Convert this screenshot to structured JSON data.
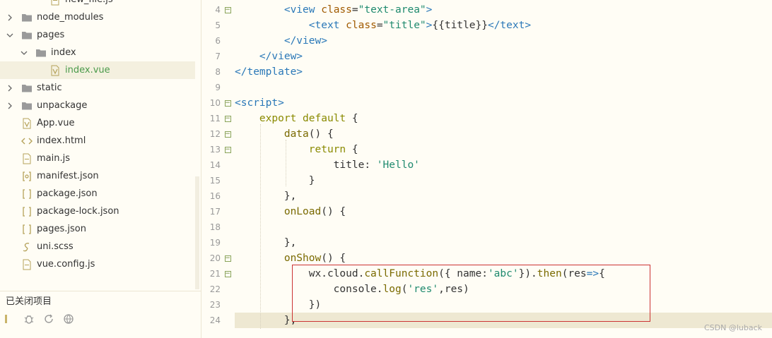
{
  "sidebar": {
    "items": [
      {
        "label": "new_file.js",
        "type": "file-js",
        "indent": 2,
        "chevron": "",
        "selected": false
      },
      {
        "label": "node_modules",
        "type": "folder",
        "indent": 0,
        "chevron": "right",
        "selected": false
      },
      {
        "label": "pages",
        "type": "folder",
        "indent": 0,
        "chevron": "down",
        "selected": false
      },
      {
        "label": "index",
        "type": "folder",
        "indent": 1,
        "chevron": "down",
        "selected": false
      },
      {
        "label": "index.vue",
        "type": "file-vue",
        "indent": 2,
        "chevron": "",
        "selected": true
      },
      {
        "label": "static",
        "type": "folder",
        "indent": 0,
        "chevron": "right",
        "selected": false
      },
      {
        "label": "unpackage",
        "type": "folder",
        "indent": 0,
        "chevron": "right",
        "selected": false
      },
      {
        "label": "App.vue",
        "type": "file-vue",
        "indent": 0,
        "chevron": "",
        "selected": false
      },
      {
        "label": "index.html",
        "type": "file-html",
        "indent": 0,
        "chevron": "",
        "selected": false
      },
      {
        "label": "main.js",
        "type": "file-js",
        "indent": 0,
        "chevron": "",
        "selected": false
      },
      {
        "label": "manifest.json",
        "type": "file-manifest",
        "indent": 0,
        "chevron": "",
        "selected": false
      },
      {
        "label": "package.json",
        "type": "file-json",
        "indent": 0,
        "chevron": "",
        "selected": false
      },
      {
        "label": "package-lock.json",
        "type": "file-json",
        "indent": 0,
        "chevron": "",
        "selected": false
      },
      {
        "label": "pages.json",
        "type": "file-json",
        "indent": 0,
        "chevron": "",
        "selected": false
      },
      {
        "label": "uni.scss",
        "type": "file-scss",
        "indent": 0,
        "chevron": "",
        "selected": false
      },
      {
        "label": "vue.config.js",
        "type": "file-js",
        "indent": 0,
        "chevron": "",
        "selected": false
      }
    ],
    "closed_projects_label": "已关闭项目",
    "toolbar_icons": [
      "collapse-icon",
      "bug-icon",
      "refresh-icon",
      "globe-icon"
    ]
  },
  "editor": {
    "current_line": 24,
    "lines": [
      {
        "n": "4",
        "fold": true,
        "tokens": [
          [
            "t-plain",
            "        "
          ],
          [
            "t-tag",
            "<view"
          ],
          [
            "t-plain",
            " "
          ],
          [
            "t-attr",
            "class"
          ],
          [
            "t-plain",
            "="
          ],
          [
            "t-str",
            "\"text-area\""
          ],
          [
            "t-tag",
            ">"
          ]
        ]
      },
      {
        "n": "5",
        "fold": false,
        "tokens": [
          [
            "t-plain",
            "            "
          ],
          [
            "t-tag",
            "<text"
          ],
          [
            "t-plain",
            " "
          ],
          [
            "t-attr",
            "class"
          ],
          [
            "t-plain",
            "="
          ],
          [
            "t-str",
            "\"title\""
          ],
          [
            "t-tag",
            ">"
          ],
          [
            "t-plain",
            "{{title}}"
          ],
          [
            "t-tag",
            "</text>"
          ]
        ]
      },
      {
        "n": "6",
        "fold": false,
        "tokens": [
          [
            "t-plain",
            "        "
          ],
          [
            "t-tag",
            "</view>"
          ]
        ]
      },
      {
        "n": "7",
        "fold": false,
        "tokens": [
          [
            "t-plain",
            "    "
          ],
          [
            "t-tag",
            "</view>"
          ]
        ]
      },
      {
        "n": "8",
        "fold": false,
        "tokens": [
          [
            "t-tag",
            "</template>"
          ]
        ]
      },
      {
        "n": "9",
        "fold": false,
        "tokens": []
      },
      {
        "n": "10",
        "fold": true,
        "tokens": [
          [
            "t-tag",
            "<script>"
          ]
        ]
      },
      {
        "n": "11",
        "fold": true,
        "tokens": [
          [
            "t-plain",
            "    "
          ],
          [
            "t-kw",
            "export default"
          ],
          [
            "t-plain",
            " {"
          ]
        ]
      },
      {
        "n": "12",
        "fold": true,
        "tokens": [
          [
            "t-plain",
            "        "
          ],
          [
            "t-fn",
            "data"
          ],
          [
            "t-plain",
            "() {"
          ]
        ]
      },
      {
        "n": "13",
        "fold": true,
        "tokens": [
          [
            "t-plain",
            "            "
          ],
          [
            "t-kw",
            "return"
          ],
          [
            "t-plain",
            " {"
          ]
        ]
      },
      {
        "n": "14",
        "fold": false,
        "tokens": [
          [
            "t-plain",
            "                title: "
          ],
          [
            "t-str",
            "'Hello'"
          ]
        ]
      },
      {
        "n": "15",
        "fold": false,
        "tokens": [
          [
            "t-plain",
            "            }"
          ]
        ]
      },
      {
        "n": "16",
        "fold": false,
        "tokens": [
          [
            "t-plain",
            "        },"
          ]
        ]
      },
      {
        "n": "17",
        "fold": false,
        "tokens": [
          [
            "t-plain",
            "        "
          ],
          [
            "t-fn",
            "onLoad"
          ],
          [
            "t-plain",
            "() {"
          ]
        ]
      },
      {
        "n": "18",
        "fold": false,
        "tokens": []
      },
      {
        "n": "19",
        "fold": false,
        "tokens": [
          [
            "t-plain",
            "        },"
          ]
        ]
      },
      {
        "n": "20",
        "fold": true,
        "tokens": [
          [
            "t-plain",
            "        "
          ],
          [
            "t-fn",
            "onShow"
          ],
          [
            "t-plain",
            "() {"
          ]
        ]
      },
      {
        "n": "21",
        "fold": true,
        "tokens": [
          [
            "t-plain",
            "            wx.cloud."
          ],
          [
            "t-fn",
            "callFunction"
          ],
          [
            "t-plain",
            "({ name:"
          ],
          [
            "t-str",
            "'abc'"
          ],
          [
            "t-plain",
            "})."
          ],
          [
            "t-fn",
            "then"
          ],
          [
            "t-plain",
            "(res"
          ],
          [
            "t-tag",
            "=>"
          ],
          [
            "t-plain",
            "{"
          ]
        ]
      },
      {
        "n": "22",
        "fold": false,
        "tokens": [
          [
            "t-plain",
            "                console."
          ],
          [
            "t-fn",
            "log"
          ],
          [
            "t-plain",
            "("
          ],
          [
            "t-str",
            "'res'"
          ],
          [
            "t-plain",
            ",res)"
          ]
        ]
      },
      {
        "n": "23",
        "fold": false,
        "tokens": [
          [
            "t-plain",
            "            })"
          ]
        ]
      },
      {
        "n": "24",
        "fold": false,
        "tokens": [
          [
            "t-plain",
            "        },"
          ]
        ]
      }
    ]
  },
  "watermark": "CSDN @luback",
  "colors": {
    "background": "#fffdf5",
    "selected_bg": "#f4f0df",
    "selected_text": "#4a9a4a",
    "highlight_box": "#cc3333",
    "current_line_bg": "#eee8d2"
  }
}
